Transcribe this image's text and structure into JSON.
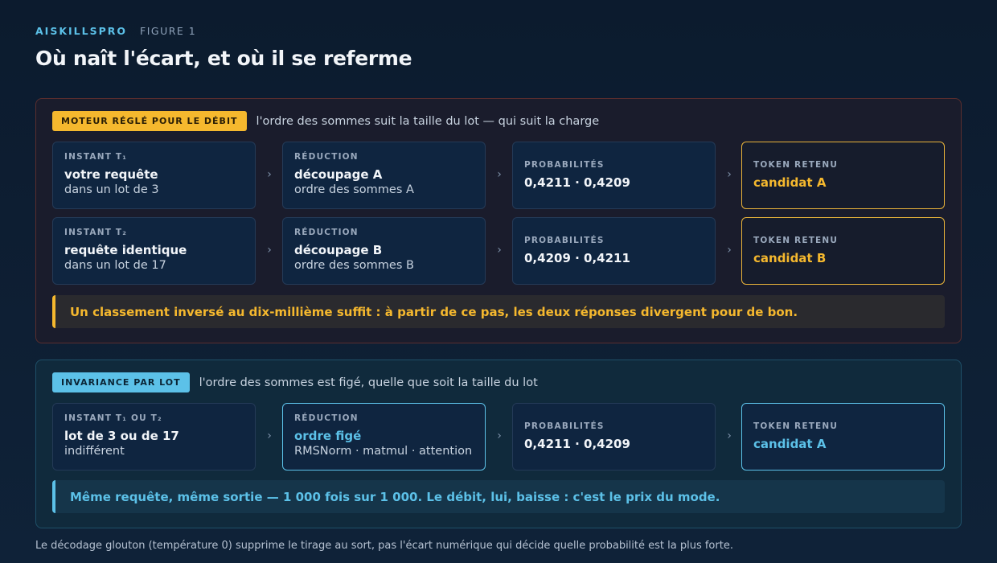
{
  "header": {
    "brand": "AISKILLSPRO",
    "figure": "FIGURE 1",
    "title": "Où naît l'écart, et où il se referme"
  },
  "top_panel": {
    "badge": "MOTEUR RÉGLÉ POUR LE DÉBIT",
    "description": "l'ordre des sommes suit la taille du lot — qui suit la charge",
    "rows": [
      {
        "instant": {
          "label": "INSTANT T₁",
          "main": "votre requête",
          "sub": "dans un lot de 3"
        },
        "reduction": {
          "label": "RÉDUCTION",
          "main": "découpage A",
          "sub": "ordre des sommes A"
        },
        "probabilities": {
          "label": "PROBABILITÉS",
          "value": "0,4211 · 0,4209"
        },
        "token": {
          "label": "TOKEN RETENU",
          "value": "candidat A"
        }
      },
      {
        "instant": {
          "label": "INSTANT T₂",
          "main": "requête identique",
          "sub": "dans un lot de 17"
        },
        "reduction": {
          "label": "RÉDUCTION",
          "main": "découpage B",
          "sub": "ordre des sommes B"
        },
        "probabilities": {
          "label": "PROBABILITÉS",
          "value": "0,4209 · 0,4211"
        },
        "token": {
          "label": "TOKEN RETENU",
          "value": "candidat B"
        }
      }
    ],
    "callout": "Un classement inversé au dix-millième suffit : à partir de ce pas, les deux réponses divergent pour de bon."
  },
  "bottom_panel": {
    "badge": "INVARIANCE PAR LOT",
    "description": "l'ordre des sommes est figé, quelle que soit la taille du lot",
    "row": {
      "instant": {
        "label": "INSTANT T₁ OU T₂",
        "main": "lot de 3 ou de 17",
        "sub": "indifférent"
      },
      "reduction": {
        "label": "RÉDUCTION",
        "main": "ordre figé",
        "sub": "RMSNorm · matmul · attention"
      },
      "probabilities": {
        "label": "PROBABILITÉS",
        "value": "0,4211 · 0,4209"
      },
      "token": {
        "label": "TOKEN RETENU",
        "value": "candidat A"
      }
    },
    "callout": "Même requête, même sortie — 1 000 fois sur 1 000. Le débit, lui, baisse : c'est le prix du mode."
  },
  "footnote": "Le décodage glouton (température 0) supprime le tirage au sort, pas l'écart numérique qui décide quelle probabilité est la plus forte.",
  "arrow_glyph": "›",
  "colors": {
    "amber": "#f5b82e",
    "cyan": "#5cc1e8",
    "background": "#0c1b2e"
  }
}
